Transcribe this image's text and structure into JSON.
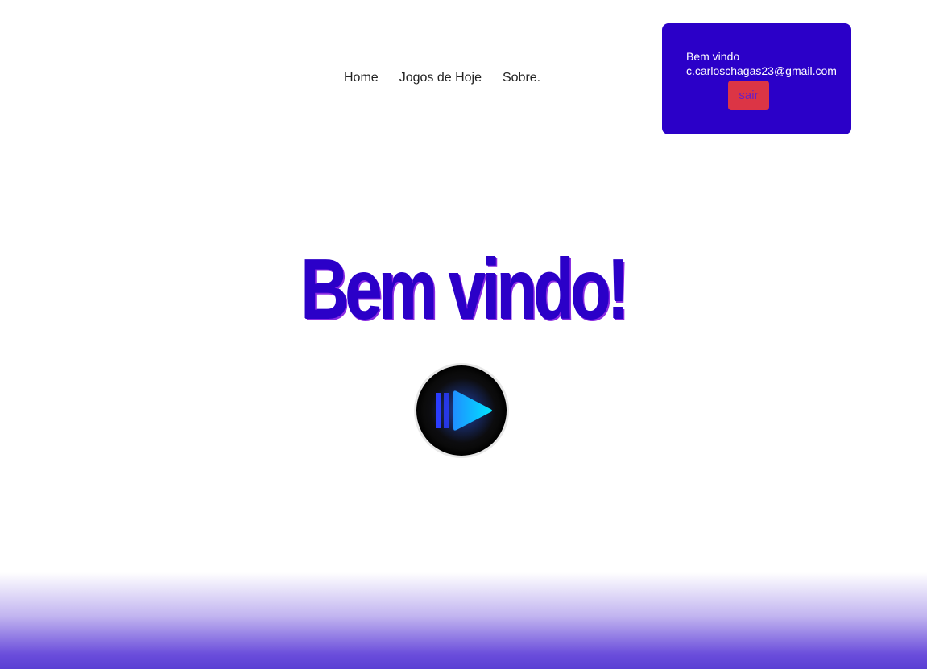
{
  "nav": {
    "items": [
      {
        "label": "Home"
      },
      {
        "label": "Jogos de Hoje"
      },
      {
        "label": "Sobre."
      }
    ]
  },
  "user_box": {
    "greeting": "Bem vindo",
    "email": "c.carloschagas23@gmail.com",
    "logout_label": "sair"
  },
  "hero": {
    "title": "Bem vindo!",
    "logo_icon": "play-button-icon"
  },
  "colors": {
    "accent": "#2b00c8",
    "logout_button": "#dc3545",
    "footer_gradient_end": "#5a3fd4"
  }
}
